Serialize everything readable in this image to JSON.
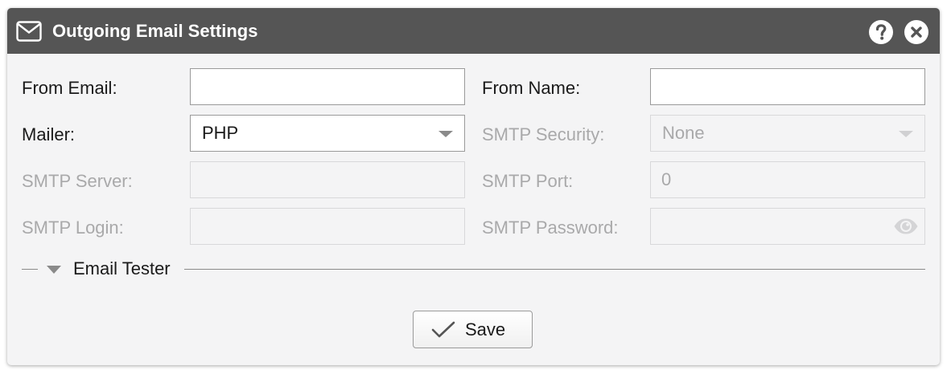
{
  "dialog": {
    "title": "Outgoing Email Settings",
    "title_icon": "envelope-icon",
    "help_icon": "help-icon",
    "close_icon": "close-icon"
  },
  "form": {
    "from_email": {
      "label": "From Email:",
      "value": ""
    },
    "from_name": {
      "label": "From Name:",
      "value": ""
    },
    "mailer": {
      "label": "Mailer:",
      "value": "PHP"
    },
    "smtp_security": {
      "label": "SMTP Security:",
      "value": "None",
      "disabled": true
    },
    "smtp_server": {
      "label": "SMTP Server:",
      "value": "",
      "disabled": true
    },
    "smtp_port": {
      "label": "SMTP Port:",
      "value": "0",
      "disabled": true
    },
    "smtp_login": {
      "label": "SMTP Login:",
      "value": "",
      "disabled": true
    },
    "smtp_password": {
      "label": "SMTP Password:",
      "value": "",
      "disabled": true,
      "icon": "eye-icon"
    }
  },
  "tester": {
    "label": "Email Tester",
    "expanded": false
  },
  "actions": {
    "save_label": "Save",
    "save_icon": "checkmark-icon"
  },
  "colors": {
    "titlebar": "#555555",
    "panel": "#f4f4f5",
    "disabled_text": "#a9a9aa"
  }
}
